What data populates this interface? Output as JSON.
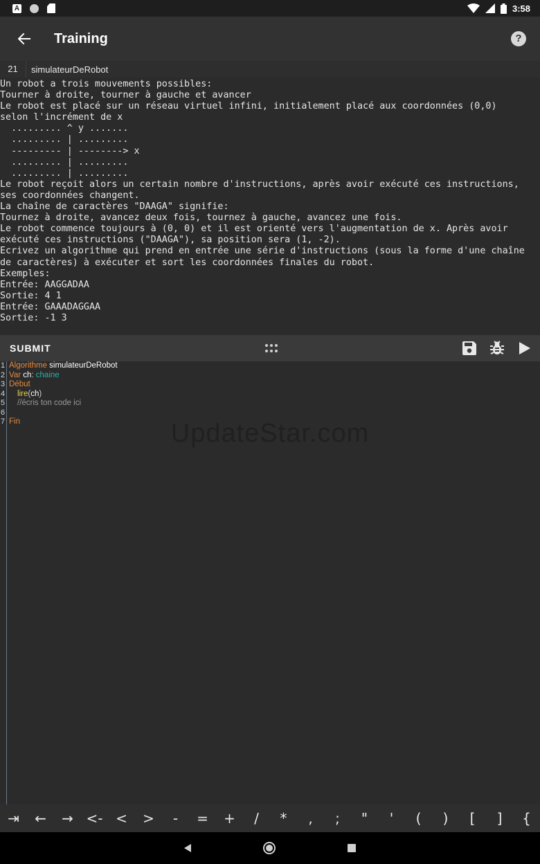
{
  "status_bar": {
    "time": "3:58",
    "left_icons": [
      "a-notification-icon",
      "circle-notification-icon",
      "sd-card-icon"
    ],
    "right_icons": [
      "wifi-icon",
      "signal-icon",
      "battery-icon"
    ]
  },
  "app_bar": {
    "title": "Training",
    "help": "?"
  },
  "problem": {
    "number": "21",
    "name": "simulateurDeRobot",
    "statement": "Un robot a trois mouvements possibles:\nTourner à droite, tourner à gauche et avancer\nLe robot est placé sur un réseau virtuel infini, initialement placé aux coordonnées (0,0)\nselon l'incrément de x\n  ......... ^ y .......\n  ......... | .........\n  --------- | --------> x\n  ......... | .........\n  ......... | .........\nLe robot reçoit alors un certain nombre d'instructions, après avoir exécuté ces instructions,\nses coordonnées changent.\nLa chaîne de caractères \"DAAGA\" signifie:\nTournez à droite, avancez deux fois, tournez à gauche, avancez une fois.\nLe robot commence toujours à (0, 0) et il est orienté vers l'augmentation de x. Après avoir\nexécuté ces instructions (\"DAAGA\"), sa position sera (1, -2).\nEcrivez un algorithme qui prend en entrée une série d'instructions (sous la forme d'une chaîne\nde caractères) à exécuter et sort les coordonnées finales du robot.\nExemples:\nEntrée: AAGGADAA\nSortie: 4 1\nEntrée: GAAADAGGAA\nSortie: -1 3"
  },
  "toolbar": {
    "submit_label": "SUBMIT",
    "icons": [
      "save-icon",
      "debug-icon",
      "run-icon"
    ]
  },
  "editor": {
    "line_numbers": [
      "1",
      "2",
      "3",
      "4",
      "5",
      "6",
      "7"
    ],
    "lines": {
      "l1_kw": "Algorithme",
      "l1_id": " simulateurDeRobot",
      "l2_kw": "Var",
      "l2_id": " ch",
      "l2_sep": ": ",
      "l2_ty": "chaine",
      "l3_kw": "Début",
      "l4_fn": "lire",
      "l4_open": "(",
      "l4_id": "ch",
      "l4_close": ")",
      "l5_cm": "//écris ton code ici",
      "l7_kw": "Fin"
    }
  },
  "watermark": "UpdateStar.com",
  "keys": [
    "⇥",
    "←",
    "→",
    "<-",
    "<",
    ">",
    "-",
    "=",
    "+",
    "/",
    "*",
    ",",
    ";",
    "\"",
    "'",
    "(",
    ")",
    "[",
    "]",
    "{"
  ],
  "colors": {
    "background": "#2b2b2b",
    "app_bar": "#323232",
    "toolbar": "#3a3a3a",
    "keyword": "#e88a3b",
    "type": "#2ab0a8",
    "function": "#e8d44d",
    "comment": "#9a9a9a"
  }
}
